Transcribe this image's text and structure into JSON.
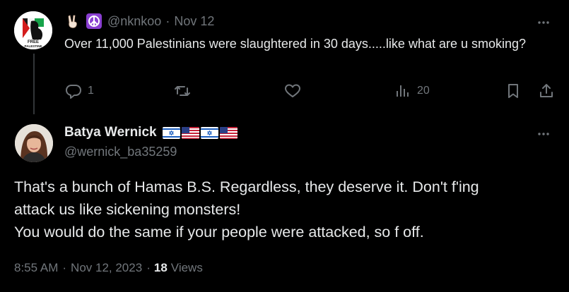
{
  "reply_tweet": {
    "avatar_text": [
      "FREE",
      "PALESTINE"
    ],
    "name_emojis": [
      "victory-hand-emoji",
      "peace-symbol-emoji"
    ],
    "handle": "@nknkoo",
    "separator": "·",
    "date": "Nov 12",
    "text": "Over 11,000 Palestinians were slaughtered in 30 days.....like what are u smoking?",
    "reply_count": "1",
    "views_count": "20"
  },
  "main_tweet": {
    "display_name": "Batya Wernick",
    "name_flags": [
      "israel-flag",
      "us-flag",
      "israel-flag",
      "us-flag"
    ],
    "handle": "@wernick_ba35259",
    "text_lines": [
      "That's a bunch of Hamas B.S. Regardless, they deserve it. Don't f'ing",
      "attack us like sickening monsters!",
      "You would do the same if your people were attacked, so f off."
    ],
    "time": "8:55 AM",
    "meta_separator": "·",
    "date": "Nov 12, 2023",
    "views_count": "18",
    "views_label": "Views"
  },
  "colors": {
    "background": "#000000",
    "text": "#e7e9ea",
    "muted": "#71767b",
    "thread_line": "#333639",
    "peace_purple": "#8a3fd1"
  },
  "icons": [
    "more-icon",
    "reply-icon",
    "retweet-icon",
    "like-icon",
    "views-icon",
    "bookmark-icon",
    "share-icon"
  ]
}
